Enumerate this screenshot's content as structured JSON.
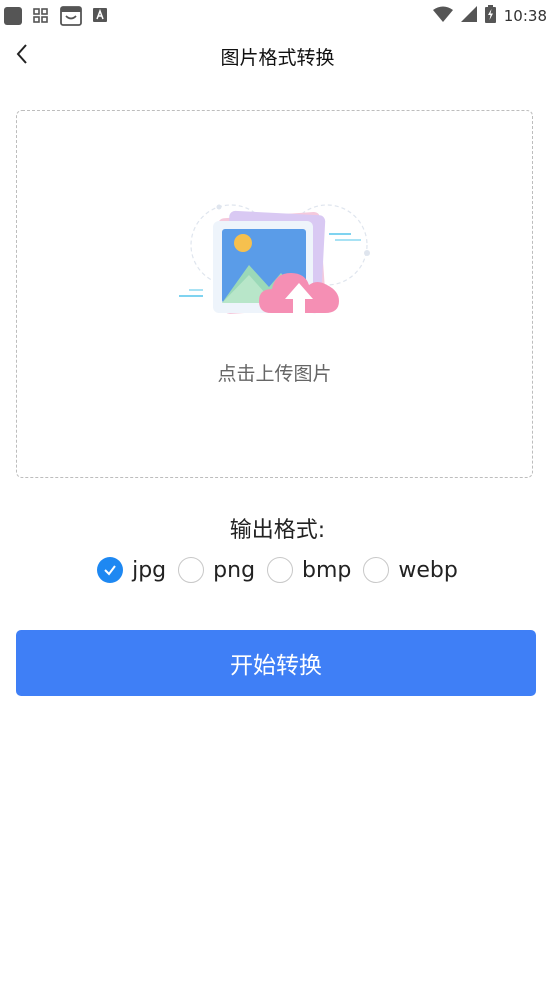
{
  "status_bar": {
    "time": "10:38",
    "icons": [
      "app-square-icon",
      "grid-apps-icon",
      "shop-icon",
      "font-a-icon",
      "wifi-icon",
      "signal-icon",
      "battery-charging-icon"
    ]
  },
  "header": {
    "title": "图片格式转换",
    "back_icon": "chevron-left-icon"
  },
  "upload": {
    "hint": "点击上传图片",
    "illustration": "image-upload-cloud-icon"
  },
  "format": {
    "label": "输出格式:",
    "options": [
      {
        "label": "jpg",
        "checked": true
      },
      {
        "label": "png",
        "checked": false
      },
      {
        "label": "bmp",
        "checked": false
      },
      {
        "label": "webp",
        "checked": false
      }
    ]
  },
  "action": {
    "start_label": "开始转换"
  },
  "colors": {
    "primary_button": "#3f7ff6",
    "radio_checked": "#1e88f2"
  }
}
